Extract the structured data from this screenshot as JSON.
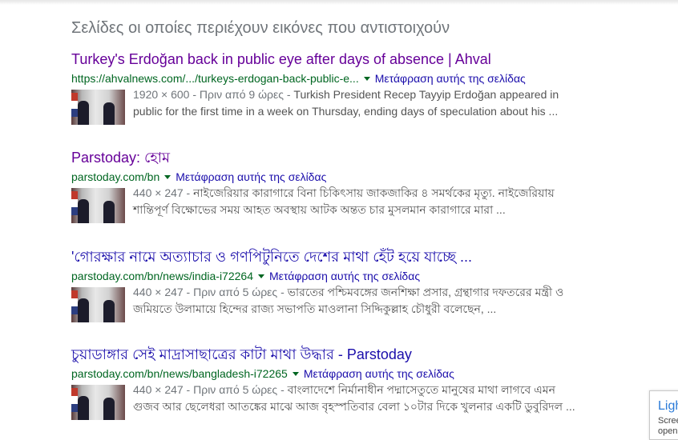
{
  "heading": "Σελίδες οι οποίες περιέχουν εικόνες που αντιστοιχούν",
  "translate_label": "Μετάφραση αυτής της σελίδας",
  "results": [
    {
      "title": "Turkey's Erdoğan back in public eye after days of absence | Ahval",
      "url": "https://ahvalnews.com/.../turkeys-erdogan-back-public-e...",
      "meta": "1920 × 600 - Πριν από 9 ώρες - ",
      "snippet": "Turkish President Recep Tayyip Erdoğan appeared in public for the first time in a week on Thursday, ending days of speculation about his ..."
    },
    {
      "title": "Parstoday: হোম",
      "url": "parstoday.com/bn",
      "meta": "440 × 247 - ",
      "snippet": "নাইজেরিয়ার কারাগারে বিনা চিকিৎসায় জাকজাকির ৪ সমর্থকের মৃত্যু. নাইজেরিয়ায় শান্তিপূর্ণ বিক্ষোভের সময় আহত অবস্থায় আটক অন্তত চার মুসলমান কারাগারে মারা ..."
    },
    {
      "title": "'গোরক্ষার নামে অত্যাচার ও গণপিটুনিতে দেশের মাথা হেঁট হয়ে যাচ্ছে ...",
      "url": "parstoday.com/bn/news/india-i72264",
      "meta": "440 × 247 - Πριν από 5 ώρες - ",
      "snippet": "ভারতের পশ্চিমবঙ্গের জনশিক্ষা প্রসার, গ্রন্থাগার দফতরের মন্ত্রী ও জমিয়তে উলামায়ে হিন্দের রাজ্য সভাপতি মাওলানা সিদ্দিকুল্লাহ চৌধুরী বলেছেন, ..."
    },
    {
      "title": "চুয়াডাঙ্গার সেই মাদ্রাসাছাত্রের কাটা মাথা উদ্ধার - Parstoday",
      "url": "parstoday.com/bn/news/bangladesh-i72265",
      "meta": "440 × 247 - Πριν από 5 ώρες - ",
      "snippet": "বাংলাদেশে নির্মানাধীন পদ্মাসেতুতে মানুষের মাথা লাগবে এমন গুজব আর ছেলেধরা আতঙ্কের মাঝে আজ বৃহস্পতিবার বেলা ১০টার দিকে খুলনার একটি ডুবুরিদল ..."
    }
  ],
  "side_panel": {
    "title": "Ligh",
    "line1": "Scree",
    "line2": "open"
  }
}
